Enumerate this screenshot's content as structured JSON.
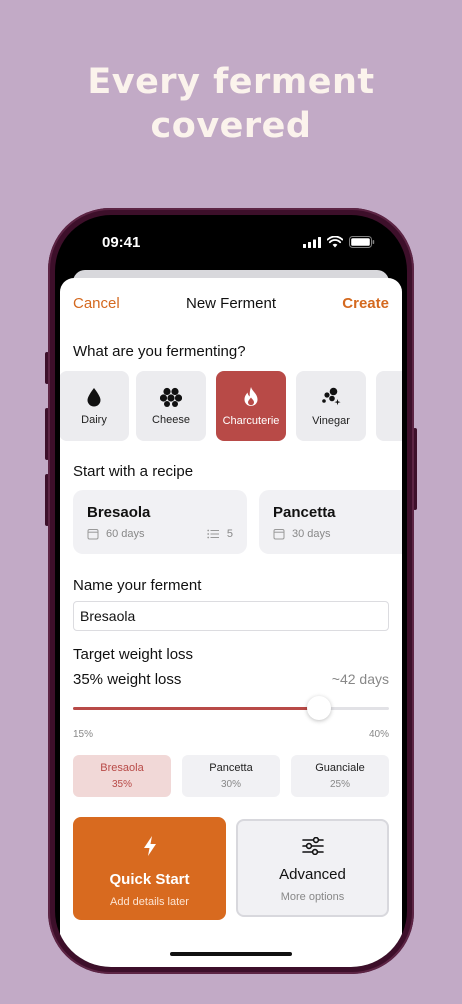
{
  "promo": {
    "line1": "Every ferment",
    "line2": "covered"
  },
  "status_bar": {
    "time": "09:41"
  },
  "nav": {
    "cancel": "Cancel",
    "title": "New Ferment",
    "create": "Create"
  },
  "categories": {
    "heading": "What are you fermenting?",
    "items": [
      {
        "label": "Dairy",
        "icon": "drop-icon",
        "selected": false
      },
      {
        "label": "Cheese",
        "icon": "cheese-icon",
        "selected": false
      },
      {
        "label": "Charcuterie",
        "icon": "flame-icon",
        "selected": true
      },
      {
        "label": "Vinegar",
        "icon": "bubbles-icon",
        "selected": false
      }
    ]
  },
  "recipes": {
    "heading": "Start with a recipe",
    "items": [
      {
        "name": "Bresaola",
        "duration": "60 days",
        "steps": "5"
      },
      {
        "name": "Pancetta",
        "duration": "30 days",
        "steps": ""
      }
    ]
  },
  "name_field": {
    "heading": "Name your ferment",
    "value": "Bresaola"
  },
  "weight_loss": {
    "heading": "Target weight loss",
    "value_label": "35% weight loss",
    "days": "~42 days",
    "min_label": "15%",
    "max_label": "40%",
    "value": 35,
    "min": 15,
    "max": 40
  },
  "presets": [
    {
      "name": "Bresaola",
      "pct": "35%",
      "selected": true
    },
    {
      "name": "Pancetta",
      "pct": "30%",
      "selected": false
    },
    {
      "name": "Guanciale",
      "pct": "25%",
      "selected": false
    }
  ],
  "actions": {
    "quick": {
      "title": "Quick Start",
      "subtitle": "Add details later"
    },
    "advanced": {
      "title": "Advanced",
      "subtitle": "More options"
    }
  },
  "colors": {
    "accent": "#d86a1f",
    "selected": "#b84a47",
    "background": "#c2aac6"
  }
}
